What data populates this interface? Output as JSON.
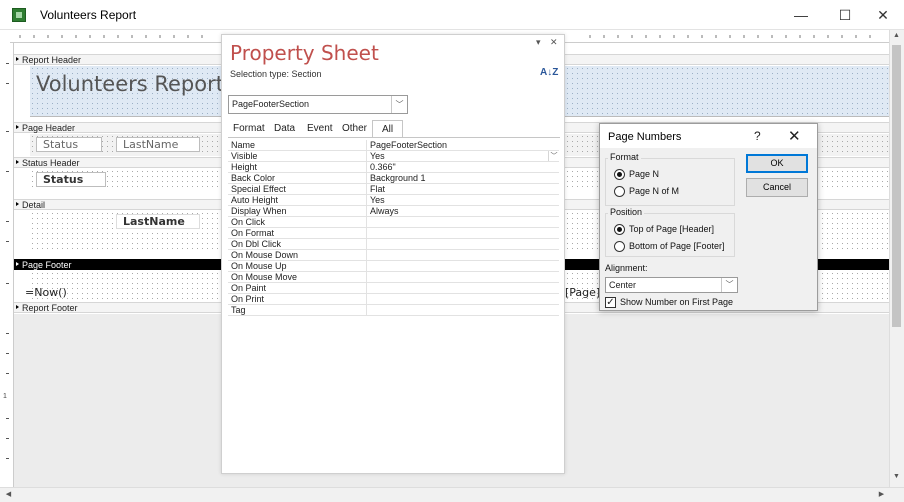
{
  "window": {
    "title": "Volunteers Report",
    "minimize": "—",
    "maximize": "☐",
    "close": "✕"
  },
  "ruler": {
    "vertical_label": "1"
  },
  "report": {
    "sections": {
      "report_header": "Report Header",
      "page_header": "Page Header",
      "status_header": "Status Header",
      "detail": "Detail",
      "page_footer": "Page Footer",
      "report_footer": "Report Footer"
    },
    "title_label": "Volunteers Report",
    "page_header_status": "Status",
    "page_header_lastname": "LastName",
    "status_header_status": "Status",
    "detail_lastname": "LastName",
    "footer_now": "=Now()",
    "footer_page": "[Page]"
  },
  "property_sheet": {
    "title": "Property Sheet",
    "selection_type": "Selection type:  Section",
    "sort_glyph": "A↓Z",
    "object": "PageFooterSection",
    "tabs": [
      "Format",
      "Data",
      "Event",
      "Other",
      "All"
    ],
    "active_tab": "All",
    "properties": [
      {
        "name": "Name",
        "value": "PageFooterSection"
      },
      {
        "name": "Visible",
        "value": "Yes"
      },
      {
        "name": "Height",
        "value": "0.366\""
      },
      {
        "name": "Back Color",
        "value": "Background 1"
      },
      {
        "name": "Special Effect",
        "value": "Flat"
      },
      {
        "name": "Auto Height",
        "value": "Yes"
      },
      {
        "name": "Display When",
        "value": "Always"
      },
      {
        "name": "On Click",
        "value": ""
      },
      {
        "name": "On Format",
        "value": ""
      },
      {
        "name": "On Dbl Click",
        "value": ""
      },
      {
        "name": "On Mouse Down",
        "value": ""
      },
      {
        "name": "On Mouse Up",
        "value": ""
      },
      {
        "name": "On Mouse Move",
        "value": ""
      },
      {
        "name": "On Paint",
        "value": ""
      },
      {
        "name": "On Print",
        "value": ""
      },
      {
        "name": "Tag",
        "value": ""
      }
    ]
  },
  "dialog": {
    "title": "Page Numbers",
    "help": "?",
    "close": "✕",
    "format_label": "Format",
    "format_options": [
      "Page N",
      "Page N of M"
    ],
    "format_selected": "Page N",
    "position_label": "Position",
    "position_options": [
      "Top of Page [Header]",
      "Bottom of Page [Footer]"
    ],
    "position_selected": "Top of Page [Header]",
    "alignment_label": "Alignment:",
    "alignment_value": "Center",
    "show_first_label": "Show Number on First Page",
    "show_first_checked": true,
    "ok": "OK",
    "cancel": "Cancel"
  },
  "colors": {
    "property_sheet_title": "#c0504d",
    "page_footer_bar": "#000000",
    "report_header_fill": "#dfe9f4",
    "ok_border": "#0078d7"
  }
}
